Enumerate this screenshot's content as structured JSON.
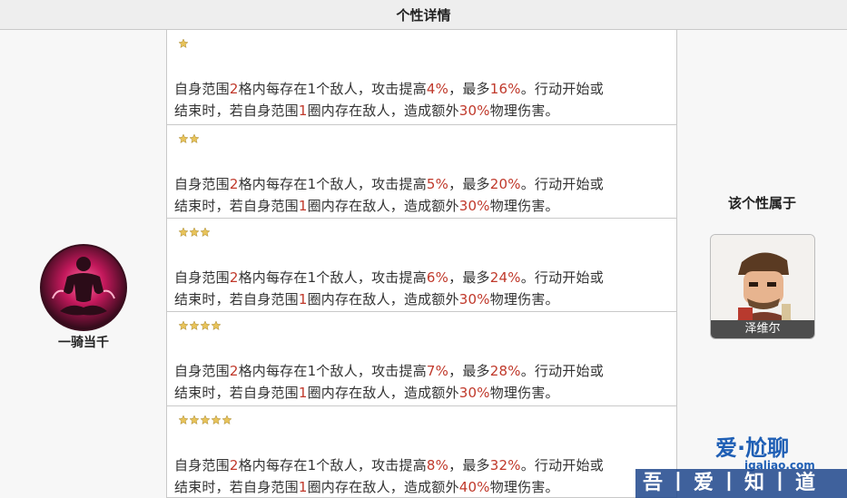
{
  "header": {
    "title": "个性详情"
  },
  "trait": {
    "name": "一骑当千",
    "icon": "meditating-warrior-icon"
  },
  "levels": [
    {
      "stars": 1,
      "seg": [
        "自身范围",
        "2",
        "格内每存在1个敌人，攻击提高",
        "4%",
        "，最多",
        "16%",
        "。行动开始或"
      ],
      "seg2": [
        "结束时，若自身范围",
        "1",
        "圈内存在敌人，造成额外",
        "30%",
        "物理伤害。"
      ]
    },
    {
      "stars": 2,
      "seg": [
        "自身范围",
        "2",
        "格内每存在1个敌人，攻击提高",
        "5%",
        "，最多",
        "20%",
        "。行动开始或"
      ],
      "seg2": [
        "结束时，若自身范围",
        "1",
        "圈内存在敌人，造成额外",
        "30%",
        "物理伤害。"
      ]
    },
    {
      "stars": 3,
      "seg": [
        "自身范围",
        "2",
        "格内每存在1个敌人，攻击提高",
        "6%",
        "，最多",
        "24%",
        "。行动开始或"
      ],
      "seg2": [
        "结束时，若自身范围",
        "1",
        "圈内存在敌人，造成额外",
        "30%",
        "物理伤害。"
      ]
    },
    {
      "stars": 4,
      "seg": [
        "自身范围",
        "2",
        "格内每存在1个敌人，攻击提高",
        "7%",
        "，最多",
        "28%",
        "。行动开始或"
      ],
      "seg2": [
        "结束时，若自身范围",
        "1",
        "圈内存在敌人，造成额外",
        "30%",
        "物理伤害。"
      ]
    },
    {
      "stars": 5,
      "seg": [
        "自身范围",
        "2",
        "格内每存在1个敌人，攻击提高",
        "8%",
        "，最多",
        "32%",
        "。行动开始或"
      ],
      "seg2": [
        "结束时，若自身范围",
        "1",
        "圈内存在敌人，造成额外",
        "40%",
        "物理伤害。"
      ]
    }
  ],
  "belongs": {
    "label": "该个性属于",
    "hero_name": "泽维尔"
  },
  "watermark": {
    "top": "爱·尬聊",
    "url": "igaliao.com",
    "bar": "吾丨爱丨知丨道"
  },
  "colors": {
    "highlight": "#c0392b",
    "star": "#e8c35a"
  }
}
